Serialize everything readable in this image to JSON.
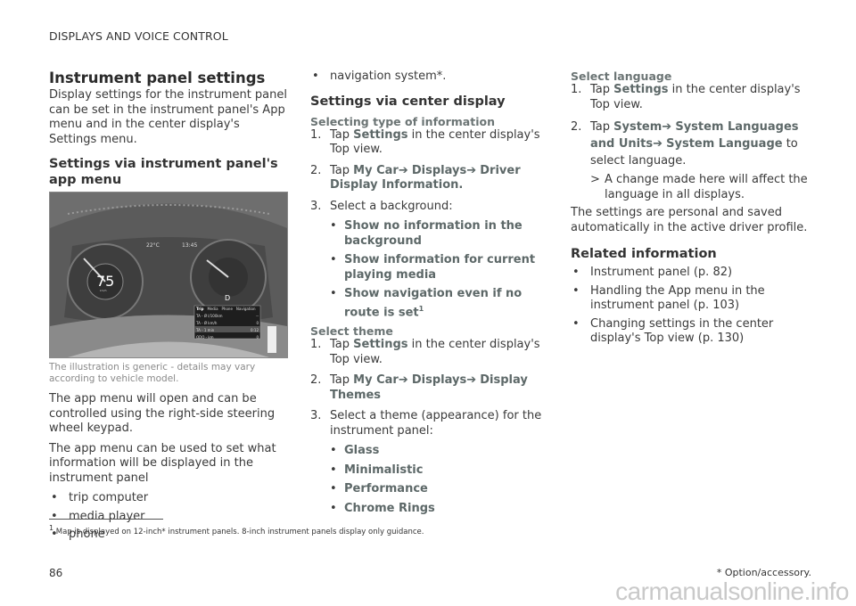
{
  "header": {
    "section": "DISPLAYS AND VOICE CONTROL"
  },
  "col1": {
    "title": "Instrument panel settings",
    "intro": "Display settings for the instrument panel can be set in the instrument panel's App menu and in the center display's Settings menu.",
    "subtitle": "Settings via instrument panel's app menu",
    "illustration": {
      "temp": "22°C",
      "time": "13:45",
      "speed": "75",
      "speed_unit": "km/h",
      "speed_ticks": [
        "0",
        "20",
        "40",
        "60",
        "80",
        "100",
        "120",
        "140",
        "160",
        "180",
        "200",
        "230",
        "260"
      ],
      "rpm_ticks": [
        "1",
        "2",
        "3",
        "4",
        "5",
        "6",
        "7"
      ],
      "gear": "D",
      "gear_letters": [
        "P",
        "R",
        "N"
      ],
      "menu_tabs": [
        "Trip",
        "Media",
        "Phone",
        "Navigation"
      ],
      "menu_rows": [
        {
          "label": "TA - Ø l/100km",
          "value": "--"
        },
        {
          "label": "TA - Ø km/h",
          "value": "0"
        },
        {
          "label": "TA - 1 min",
          "value": "0:12"
        },
        {
          "label": "ODO - km",
          "value": "0"
        }
      ],
      "code": "G000000"
    },
    "caption": "The illustration is generic - details may vary according to vehicle model.",
    "p1": "The app menu will open and can be controlled using the right-side steering wheel keypad.",
    "p2": "The app menu can be used to set what information will be displayed in the instrument panel",
    "bullets": [
      "trip computer",
      "media player",
      "phone"
    ]
  },
  "col2": {
    "bullet_nav": "navigation system*.",
    "h2": "Settings via center display",
    "h3_info": "Selecting type of information",
    "info_steps": {
      "s1": {
        "pre": "Tap ",
        "hl": "Settings",
        "post": " in the center display's Top view."
      },
      "s2": {
        "pre": "Tap ",
        "p1": "My Car",
        "p2": "Displays",
        "p3": "Driver Display Information."
      },
      "s3": "Select a background:"
    },
    "backgrounds": [
      "Show no information in the background",
      "Show information for current playing media",
      "Show navigation even if no route is set"
    ],
    "footnote_ref": "1",
    "h3_theme": "Select theme",
    "theme_steps": {
      "s1": {
        "pre": "Tap ",
        "hl": "Settings",
        "post": " in the center display's Top view."
      },
      "s2": {
        "pre": "Tap ",
        "p1": "My Car",
        "p2": "Displays",
        "p3": "Display Themes"
      },
      "s3": "Select a theme (appearance) for the instrument panel:"
    },
    "themes": [
      "Glass",
      "Minimalistic",
      "Performance",
      "Chrome Rings"
    ]
  },
  "col3": {
    "h3_lang": "Select language",
    "lang_steps": {
      "s1": {
        "pre": "Tap ",
        "hl": "Settings",
        "post": " in the center display's Top view."
      },
      "s2": {
        "pre": "Tap ",
        "p1": "System",
        "p2": "System Languages and Units",
        "p3": "System Language",
        "post": " to select language."
      },
      "result": "A change made here will affect the language in all displays."
    },
    "saved": "The settings are personal and saved automatically in the active driver profile.",
    "related_title": "Related information",
    "related": [
      "Instrument panel (p. 82)",
      "Handling the App menu in the instrument panel (p. 103)",
      "Changing settings in the center display's Top view (p. 130)"
    ]
  },
  "footnote": {
    "num": "1",
    "text": "Map is displayed on 12-inch* instrument panels. 8-inch instrument panels display only guidance."
  },
  "footer": {
    "page": "86",
    "option": "* Option/accessory.",
    "watermark": "carmanualsonline.info"
  },
  "glyphs": {
    "bullet": "•",
    "arrow": "➔",
    "result": ">"
  },
  "colors": {
    "highlight": "#5d6868",
    "text": "#3a3a3a"
  }
}
